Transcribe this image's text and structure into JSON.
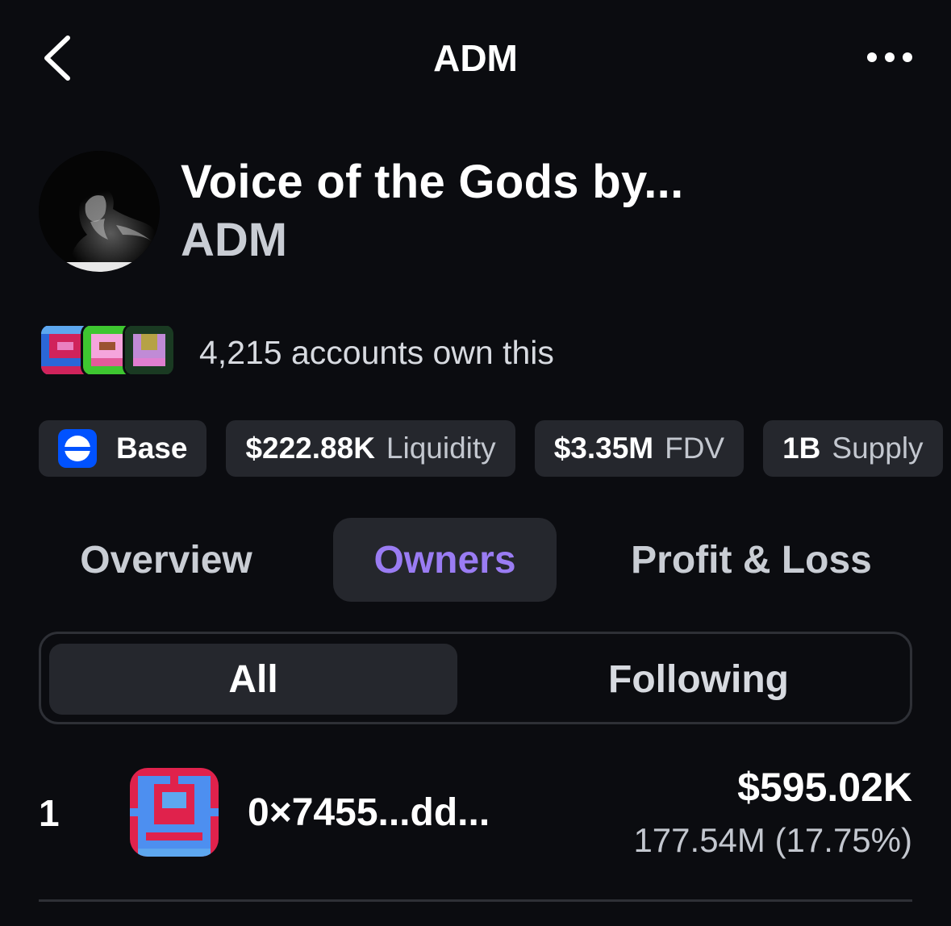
{
  "header": {
    "title": "ADM",
    "back_icon": "chevron-left-icon",
    "more_icon": "more-horizontal-icon"
  },
  "token": {
    "name": "Voice of the Gods by...",
    "symbol": "ADM"
  },
  "owners_summary": {
    "text": "4,215 accounts own this"
  },
  "chips": {
    "network": {
      "label": "Base",
      "icon": "base-network-icon",
      "color": "#0052ff"
    },
    "liquidity": {
      "value": "$222.88K",
      "label": "Liquidity"
    },
    "fdv": {
      "value": "$3.35M",
      "label": "FDV"
    },
    "supply": {
      "value": "1B",
      "label": "Supply"
    }
  },
  "tabs": [
    {
      "label": "Overview",
      "active": false
    },
    {
      "label": "Owners",
      "active": true
    },
    {
      "label": "Profit & Loss",
      "active": false
    }
  ],
  "filter": {
    "all_label": "All",
    "following_label": "Following",
    "selected": "All"
  },
  "holders": [
    {
      "rank": "1",
      "address": "0×7455...dd...",
      "usd_value": "$595.02K",
      "amount": "177.54M (17.75%)"
    }
  ],
  "colors": {
    "background": "#0b0c10",
    "surface": "#25272d",
    "accent": "#9a7cf3",
    "muted_text": "#c3c7cf"
  }
}
